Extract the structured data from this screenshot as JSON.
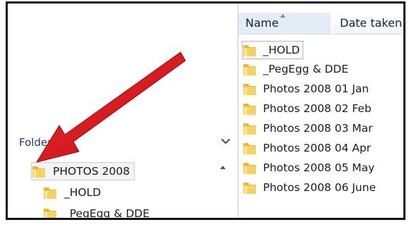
{
  "nav_pane": {
    "header_label": "Folders",
    "header_icon": "chevron-down-icon",
    "tree_items": [
      {
        "label": "PHOTOS 2008",
        "selected": true
      },
      {
        "label": "_HOLD"
      },
      {
        "label": "_PegEgg & DDE"
      }
    ]
  },
  "file_list": {
    "columns": [
      {
        "label": "Name",
        "sorted": "ascending"
      },
      {
        "label": "Date taken"
      }
    ],
    "items": [
      "_HOLD",
      "_PegEgg & DDE",
      "Photos 2008 01 Jan",
      "Photos 2008 02 Feb",
      "Photos 2008 03 Mar",
      "Photos 2008 04 Apr",
      "Photos 2008 05 May",
      "Photos 2008 06 June"
    ]
  },
  "colors": {
    "annotation_arrow": "#d8181c",
    "folder_yellow": "#f2c744",
    "header_blue": "#e3edf8",
    "chevron_blue": "#2c5aa0"
  },
  "annotation": {
    "type": "arrow",
    "points_to": "PHOTOS 2008"
  }
}
